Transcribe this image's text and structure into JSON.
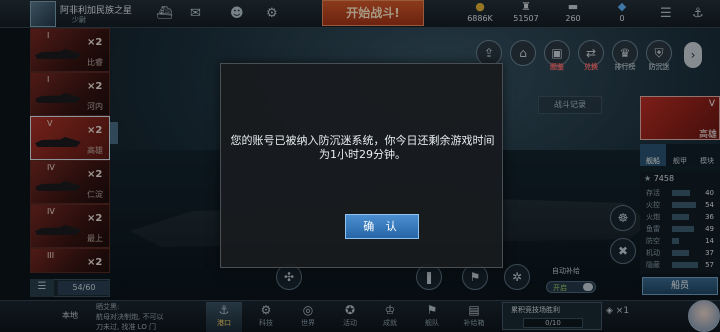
{
  "player": {
    "name": "阿非利加民族之星",
    "rank": "少尉"
  },
  "top_nav": {
    "battle_button": "开始战斗!",
    "resources": [
      {
        "icon": "coin-icon",
        "value": "6886K"
      },
      {
        "icon": "fuel-icon",
        "value": "51507"
      },
      {
        "icon": "ammo-icon",
        "value": "260"
      },
      {
        "icon": "diamond-icon",
        "value": "0"
      }
    ]
  },
  "features": [
    {
      "icon": "share-icon",
      "label": ""
    },
    {
      "icon": "home-icon",
      "label": ""
    },
    {
      "icon": "atlas-icon",
      "label": "图鉴"
    },
    {
      "icon": "exchange-icon",
      "label": "兑换"
    },
    {
      "icon": "ranking-icon",
      "label": "排行榜"
    },
    {
      "icon": "anti-addiction-icon",
      "label": "防沉迷"
    }
  ],
  "battle_record": "战斗记录",
  "ship_list": {
    "ships": [
      {
        "tier": "I",
        "mult": "×2",
        "name": "比睿"
      },
      {
        "tier": "I",
        "mult": "×2",
        "name": "河内"
      },
      {
        "tier": "V",
        "mult": "×2",
        "name": "高雄",
        "selected": true
      },
      {
        "tier": "IV",
        "mult": "×2",
        "name": "仁淀"
      },
      {
        "tier": "IV",
        "mult": "×2",
        "name": "最上"
      },
      {
        "tier": "III",
        "mult": "×2",
        "name": ""
      }
    ],
    "count": "54/60"
  },
  "ship_panel": {
    "tier": "V",
    "name": "高雄",
    "tabs": [
      "舰船",
      "舰甲",
      "模块"
    ],
    "total": "7458",
    "stats": [
      {
        "label": "存活",
        "value": "40",
        "fill": 0.6
      },
      {
        "label": "火控",
        "value": "54",
        "fill": 0.8
      },
      {
        "label": "火炮",
        "value": "36",
        "fill": 0.55
      },
      {
        "label": "鱼雷",
        "value": "49",
        "fill": 0.72
      },
      {
        "label": "防空",
        "value": "14",
        "fill": 0.22
      },
      {
        "label": "机动",
        "value": "37",
        "fill": 0.56
      },
      {
        "label": "隐蔽",
        "value": "57",
        "fill": 0.86
      }
    ],
    "crew_button": "船员"
  },
  "auto_supply": {
    "label": "自动补给",
    "state": "开启"
  },
  "bottom_nav": {
    "local_label": "本地",
    "chat_lines": [
      "晒艾黑:",
      "航母对决制炮, 不可以",
      "刀未过, 找准 LO 门"
    ],
    "items": [
      {
        "icon": "harbor-icon",
        "label": "港口",
        "active": true
      },
      {
        "icon": "tech-icon",
        "label": "科技"
      },
      {
        "icon": "world-icon",
        "label": "世界"
      },
      {
        "icon": "event-icon",
        "label": "活动"
      },
      {
        "icon": "achievement-icon",
        "label": "成就"
      },
      {
        "icon": "fleet-icon",
        "label": "舰队"
      },
      {
        "icon": "depot-icon",
        "label": "补给箱"
      }
    ],
    "event": {
      "title": "累积竞技场胜利",
      "progress": "0/10"
    },
    "gift": "×1"
  },
  "modal": {
    "message": "您的账号已被纳入防沉迷系统，你今日还剩余游戏时间为1小时29分钟。",
    "confirm": "确 认"
  }
}
